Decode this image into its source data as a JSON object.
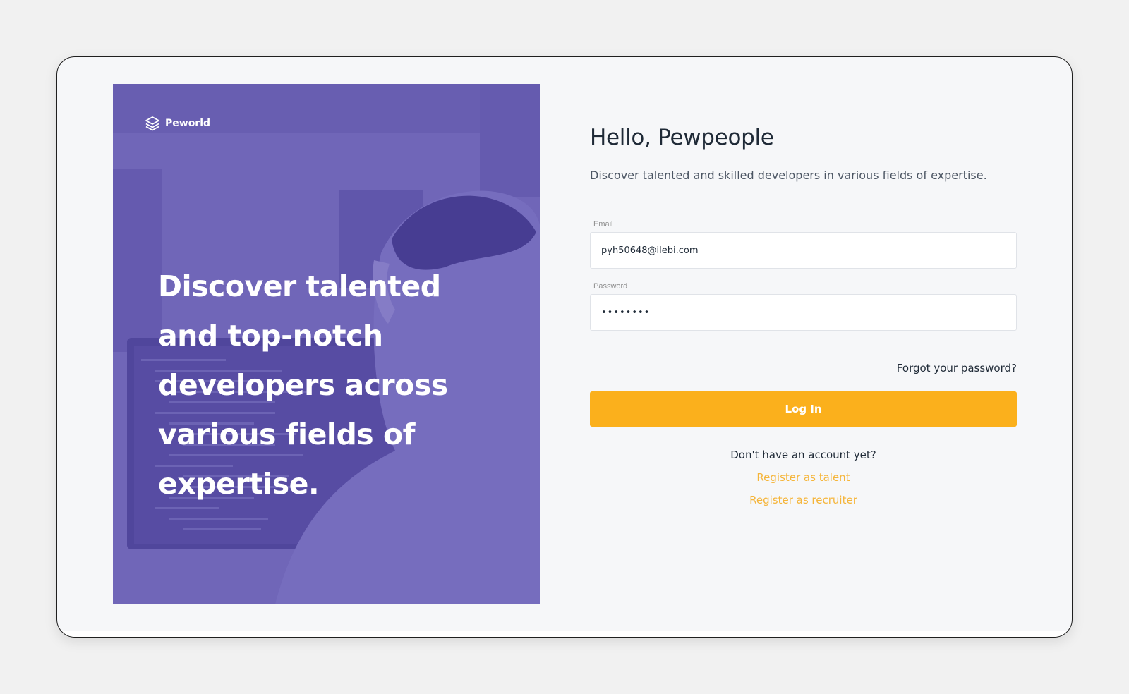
{
  "brand": {
    "name": "Peworld",
    "logo_icon": "layers-icon"
  },
  "hero": {
    "headline": "Discover talented and top-notch developers across various fields of expertise."
  },
  "form": {
    "title": "Hello, Pewpeople",
    "subtitle": "Discover talented and skilled developers in various fields of expertise.",
    "email_label": "Email",
    "email_value": "pyh50648@ilebi.com",
    "password_label": "Password",
    "password_value": "••••••••",
    "forgot_label": "Forgot your password?",
    "login_label": "Log In",
    "no_account_text": "Don't have an account yet?",
    "register_talent_label": "Register as talent",
    "register_recruiter_label": "Register as recruiter"
  },
  "colors": {
    "accent": "#fbb01c",
    "link": "#f5b53a",
    "hero_overlay": "#7b72bb",
    "text_dark": "#1f2a37"
  }
}
